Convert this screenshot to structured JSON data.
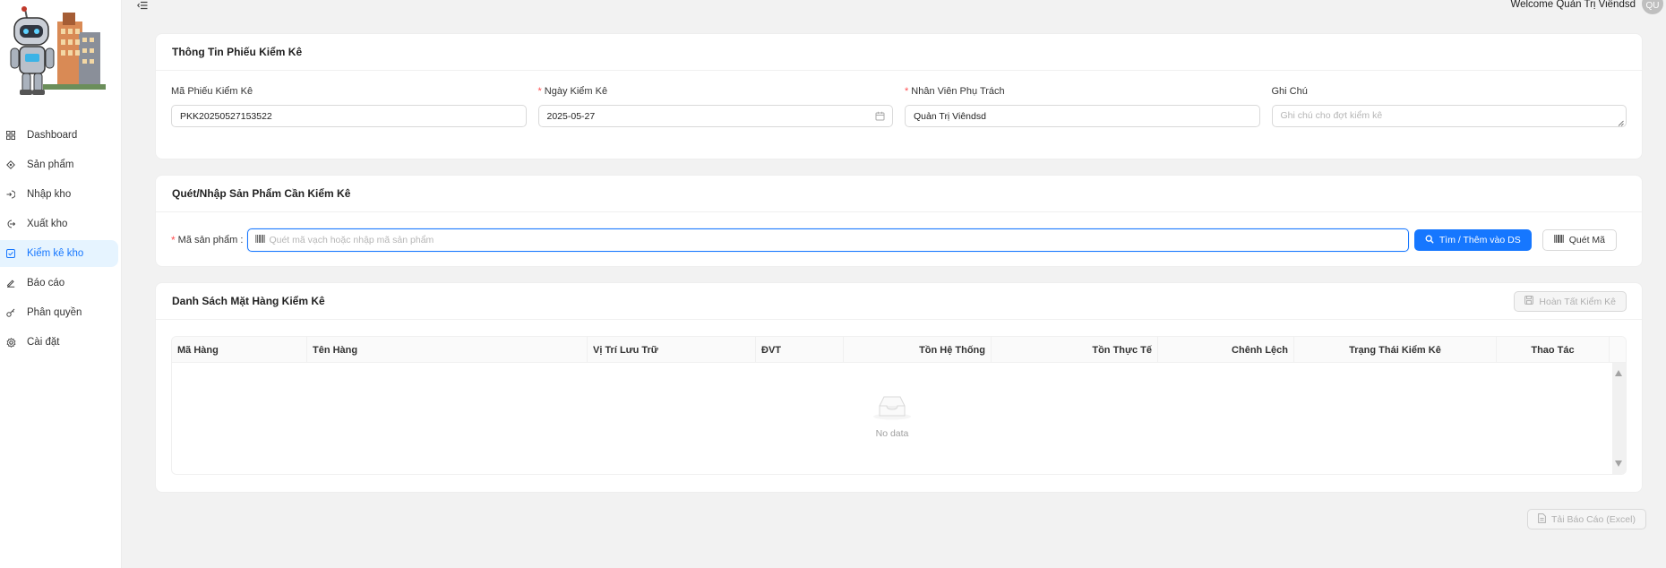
{
  "header": {
    "welcome": "Welcome Quản Trị Viêndsd",
    "avatar_initials": "QU"
  },
  "sidebar": {
    "items": [
      {
        "label": "Dashboard",
        "icon": "dashboard-icon"
      },
      {
        "label": "Sản phẩm",
        "icon": "product-icon"
      },
      {
        "label": "Nhập kho",
        "icon": "import-icon"
      },
      {
        "label": "Xuất kho",
        "icon": "export-icon"
      },
      {
        "label": "Kiểm kê kho",
        "icon": "checklist-icon",
        "active": true
      },
      {
        "label": "Báo cáo",
        "icon": "report-icon"
      },
      {
        "label": "Phân quyền",
        "icon": "key-icon"
      },
      {
        "label": "Cài đặt",
        "icon": "gear-icon"
      }
    ]
  },
  "info": {
    "title": "Thông Tin Phiếu Kiểm Kê",
    "code_label": "Mã Phiếu Kiểm Kê",
    "code_value": "PKK20250527153522",
    "date_label": "Ngày Kiểm Kê",
    "date_value": "2025-05-27",
    "staff_label": "Nhân Viên Phụ Trách",
    "staff_value": "Quản Trị Viêndsd",
    "note_label": "Ghi Chú",
    "note_placeholder": "Ghi chú cho đợt kiểm kê"
  },
  "scan": {
    "title": "Quét/Nhập Sản Phẩm Cần Kiểm Kê",
    "label": "Mã sản phẩm :",
    "placeholder": "Quét mã vạch hoặc nhập mã sản phẩm",
    "search_button": "Tìm / Thêm vào DS",
    "scan_button": "Quét Mã"
  },
  "list": {
    "title": "Danh Sách Mặt Hàng Kiểm Kê",
    "complete_button": "Hoàn Tất Kiểm Kê",
    "columns": [
      "Mã Hàng",
      "Tên Hàng",
      "Vị Trí Lưu Trữ",
      "ĐVT",
      "Tồn Hệ Thống",
      "Tồn Thực Tế",
      "Chênh Lệch",
      "Trạng Thái Kiểm Kê",
      "Thao Tác"
    ],
    "empty_text": "No data"
  },
  "download_button": "Tải Báo Cáo (Excel)",
  "colors": {
    "primary": "#1677ff",
    "active_bg": "#e6f4ff",
    "required": "#ff4d4f",
    "background": "#f2f2f2"
  }
}
